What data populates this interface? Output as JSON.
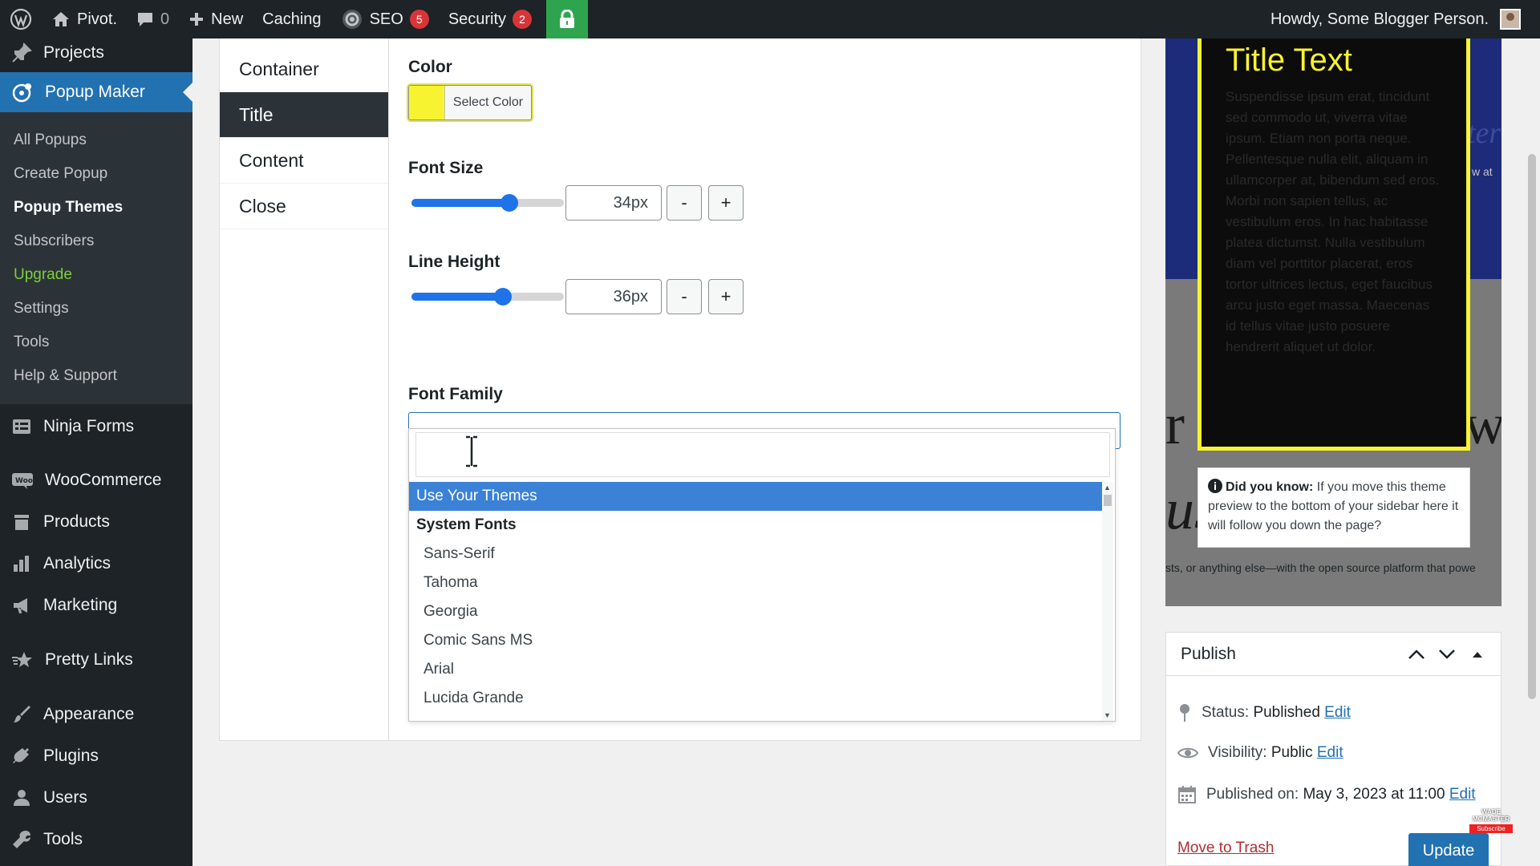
{
  "adminbar": {
    "site_name": "Pivot.",
    "comments_count": "0",
    "new_label": "New",
    "caching_label": "Caching",
    "seo_label": "SEO",
    "seo_badge": "5",
    "security_label": "Security",
    "security_badge": "2",
    "howdy": "Howdy, Some Blogger Person."
  },
  "sidebar": {
    "top_items": [
      {
        "label": "Projects",
        "icon": "pin-icon"
      },
      {
        "label": "Popup Maker",
        "icon": "popup-maker-icon"
      }
    ],
    "submenu": [
      "All Popups",
      "Create Popup",
      "Popup Themes",
      "Subscribers",
      "Upgrade",
      "Settings",
      "Tools",
      "Help & Support"
    ],
    "items": [
      {
        "label": "Ninja Forms",
        "icon": "form-icon"
      },
      {
        "label": "WooCommerce",
        "icon": "woo-icon"
      },
      {
        "label": "Products",
        "icon": "archive-icon"
      },
      {
        "label": "Analytics",
        "icon": "chart-icon"
      },
      {
        "label": "Marketing",
        "icon": "megaphone-icon"
      },
      {
        "label": "Pretty Links",
        "icon": "star-icon"
      },
      {
        "label": "Appearance",
        "icon": "brush-icon"
      },
      {
        "label": "Plugins",
        "icon": "plug-icon"
      },
      {
        "label": "Users",
        "icon": "user-icon"
      },
      {
        "label": "Tools",
        "icon": "wrench-icon"
      }
    ]
  },
  "tabs": [
    "Container",
    "Title",
    "Content",
    "Close"
  ],
  "fields": {
    "color_label": "Color",
    "select_color": "Select Color",
    "color_value": "#f7f331",
    "font_size_label": "Font Size",
    "font_size_value": "34px",
    "font_size_level": 0.64,
    "line_height_label": "Line Height",
    "line_height_value": "36px",
    "line_height_level": 0.6,
    "minus": "-",
    "plus": "+",
    "font_family_label": "Font Family"
  },
  "font_options": [
    {
      "label": "Use Your Themes",
      "kind": "highlight"
    },
    {
      "label": "System Fonts",
      "kind": "group"
    },
    {
      "label": "Sans-Serif",
      "kind": "option"
    },
    {
      "label": "Tahoma",
      "kind": "option"
    },
    {
      "label": "Georgia",
      "kind": "option"
    },
    {
      "label": "Comic Sans MS",
      "kind": "option"
    },
    {
      "label": "Arial",
      "kind": "option"
    },
    {
      "label": "Lucida Grande",
      "kind": "option"
    }
  ],
  "preview": {
    "title": "Title Text",
    "body": "Suspendisse ipsum erat, tincidunt sed commodo ut, viverra vitae ipsum. Etiam non porta neque. Pellentesque nulla elit, aliquam in ullamcorper at, bibendum sed eros. Morbi non sapien tellus, ac vestibulum eros. In hac habitasse platea dictumst. Nulla vestibulum diam vel porttitor placerat, eros tortor ultrices lectus, eget faucibus arcu justo eget massa. Maecenas id tellus vitae justo posuere hendrerit aliquet ut dolor.",
    "tip_bold": "Did you know:",
    "tip_text": "If you move this theme preview to the bottom of your sidebar here it will follow you down the page?",
    "bg_text": "sts, or anything else—with the open source platform that powe",
    "bg_word_left": "r",
    "bg_word_right": "w",
    "bg_word2": "us",
    "bg_italic": "ter",
    "bg_small": "w at"
  },
  "publish": {
    "title": "Publish",
    "status_label": "Status:",
    "status_value": "Published",
    "visibility_label": "Visibility:",
    "visibility_value": "Public",
    "published_label": "Published on:",
    "published_value": "May 3, 2023 at 11:00",
    "edit": "Edit",
    "trash": "Move to Trash",
    "update": "Update"
  },
  "watermark": {
    "text": "WADE MCMASTER",
    "sub": "Subscribe"
  }
}
